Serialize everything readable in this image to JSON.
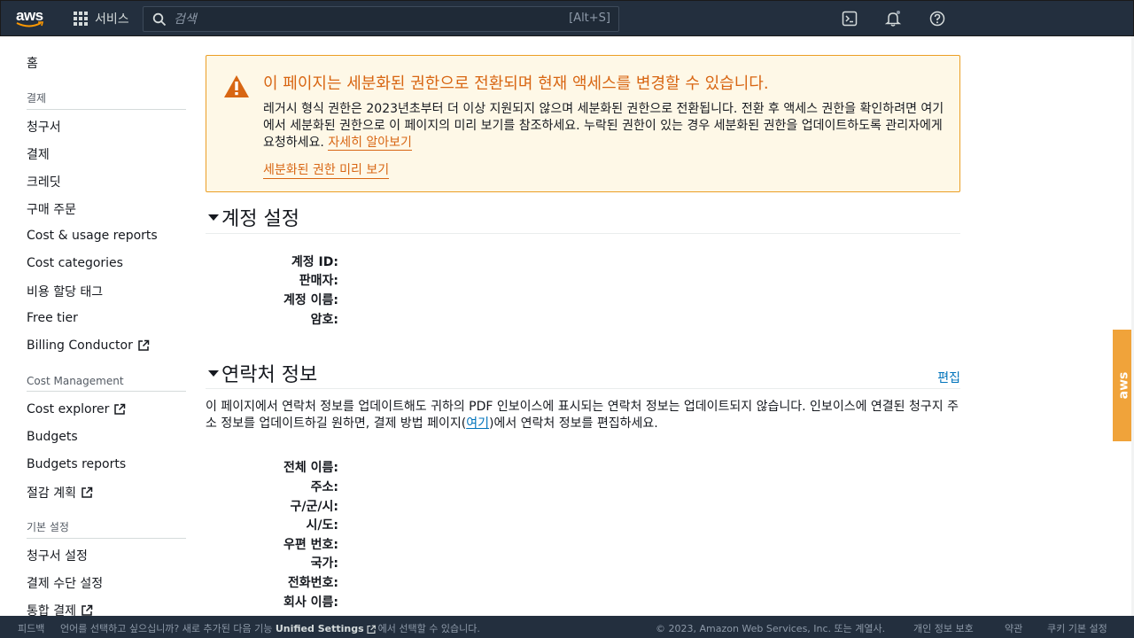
{
  "topbar": {
    "logo": "aws",
    "services_label": "서비스",
    "search_placeholder": "검색",
    "search_shortcut": "[Alt+S]",
    "icons": [
      "cloudshell-icon",
      "bell-icon",
      "help-icon"
    ]
  },
  "sidebar": {
    "home": "홈",
    "sections": [
      {
        "title": "결제",
        "items": [
          {
            "label": "청구서"
          },
          {
            "label": "결제"
          },
          {
            "label": "크레딧"
          },
          {
            "label": "구매 주문"
          },
          {
            "label": "Cost & usage reports"
          },
          {
            "label": "Cost categories"
          },
          {
            "label": "비용 할당 태그"
          },
          {
            "label": "Free tier"
          },
          {
            "label": "Billing Conductor",
            "external": true
          }
        ]
      },
      {
        "title": "Cost Management",
        "items": [
          {
            "label": "Cost explorer",
            "external": true
          },
          {
            "label": "Budgets"
          },
          {
            "label": "Budgets reports"
          },
          {
            "label": "절감 계획",
            "external": true
          }
        ]
      },
      {
        "title": "기본 설정",
        "items": [
          {
            "label": "청구서 설정"
          },
          {
            "label": "결제 수단 설정"
          },
          {
            "label": "통합 결제",
            "external": true
          }
        ]
      }
    ]
  },
  "alert": {
    "title": "이 페이지는 세분화된 권한으로 전환되며 현재 액세스를 변경할 수 있습니다.",
    "body": "레거시 형식 권한은 2023년초부터 더 이상 지원되지 않으며 세분화된 권한으로 전환됩니다. 전환 후 액세스 권한을 확인하려면 여기에서 세분화된 권한으로 이 페이지의 미리 보기를 참조하세요. 누락된 권한이 있는 경우 세분화된 권한을 업데이트하도록 관리자에게 요청하세요.",
    "learn_more": "자세히 알아보기",
    "preview_link": "세분화된 권한 미리 보기"
  },
  "account_settings": {
    "title": "계정 설정",
    "fields": [
      {
        "label": "계정 ID:"
      },
      {
        "label": "판매자:"
      },
      {
        "label": "계정 이름:"
      },
      {
        "label": "암호:"
      }
    ]
  },
  "contact_info": {
    "title": "연락처 정보",
    "edit": "편집",
    "desc_before": "이 페이지에서 연락처 정보를 업데이트해도 귀하의 PDF 인보이스에 표시되는 연락처 정보는 업데이트되지 않습니다. 인보이스에 연결된 청구지 주소 정보를 업데이트하길 원하면, 결제 방법 페이지(",
    "desc_link": "여기",
    "desc_after": ")에서 연락처 정보를 편집하세요.",
    "fields": [
      {
        "label": "전체 이름:"
      },
      {
        "label": "주소:"
      },
      {
        "label": "구/군/시:"
      },
      {
        "label": "시/도:"
      },
      {
        "label": "우편 번호:"
      },
      {
        "label": "국가:"
      },
      {
        "label": "전화번호:"
      },
      {
        "label": "회사 이름:"
      }
    ]
  },
  "feedback_tab": "aws",
  "footer": {
    "feedback": "피드백",
    "lang_prompt": "언어를 선택하고 싶으십니까? 새로 추가된 다음 기능",
    "unified_settings": "Unified Settings",
    "lang_prompt_after": "에서 선택할 수 있습니다.",
    "copyright": "© 2023, Amazon Web Services, Inc. 또는 계열사.",
    "privacy": "개인 정보 보호",
    "terms": "약관",
    "cookies": "쿠키 기본 설정"
  }
}
